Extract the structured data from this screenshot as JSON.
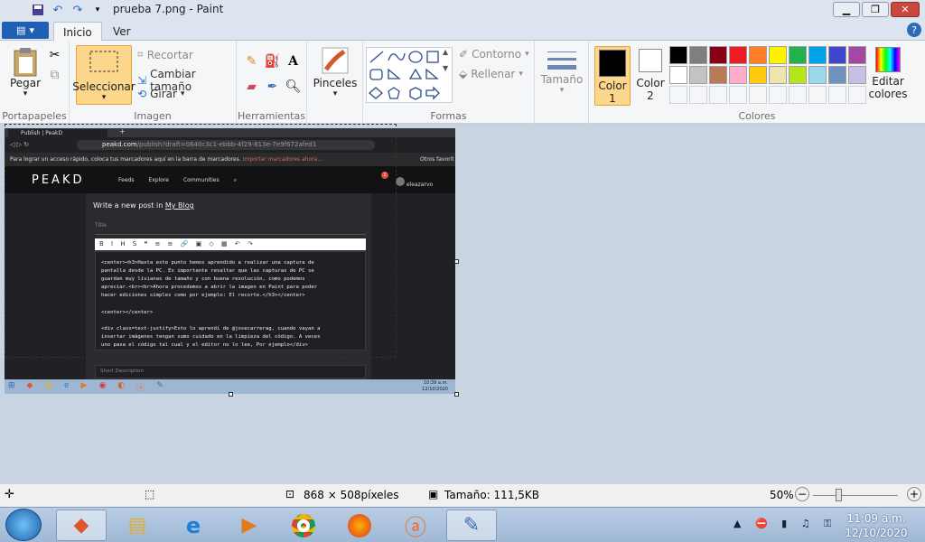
{
  "window": {
    "title": "prueba 7.png - Paint"
  },
  "tabs": [
    {
      "label": "Inicio"
    },
    {
      "label": "Ver"
    }
  ],
  "ribbon": {
    "clipboard": {
      "paste": "Pegar",
      "label": "Portapapeles"
    },
    "image": {
      "select": "Seleccionar",
      "crop": "Recortar",
      "resize": "Cambiar tamaño",
      "rotate": "Girar",
      "label": "Imagen"
    },
    "tools": {
      "label": "Herramientas"
    },
    "brushes": {
      "label": "Pinceles"
    },
    "shapes": {
      "outline": "Contorno",
      "fill": "Rellenar",
      "label": "Formas"
    },
    "size": {
      "label": "Tamaño"
    },
    "colors": {
      "color1_a": "Color",
      "color1_b": "1",
      "color2_a": "Color",
      "color2_b": "2",
      "edit_a": "Editar",
      "edit_b": "colores",
      "label": "Colores",
      "palette": [
        "#000000",
        "#7f7f7f",
        "#880015",
        "#ed1c24",
        "#ff7f27",
        "#fff200",
        "#22b14c",
        "#00a2e8",
        "#3f48cc",
        "#a349a4",
        "#ffffff",
        "#c3c3c3",
        "#b97a57",
        "#ffaec9",
        "#ffc90e",
        "#efe4b0",
        "#b5e61d",
        "#99d9ea",
        "#7092be",
        "#c8bfe7",
        "#f5f6f7",
        "#f5f6f7",
        "#f5f6f7",
        "#f5f6f7",
        "#f5f6f7",
        "#f5f6f7",
        "#f5f6f7",
        "#f5f6f7",
        "#f5f6f7",
        "#f5f6f7"
      ]
    }
  },
  "screenshot": {
    "tab_title": "Publish | PeakD",
    "url_host": "peakd.com",
    "url_path": "/publish?draft=0640c3c1-ebbb-4f29-813e-7e9f672afed1",
    "bookmark_hint": "Para lograr un acceso rápido, coloca tus marcadores aquí en la barra de marcadores.",
    "bookmark_link": "Importar marcadores ahora...",
    "other_favs": "Otros favorit",
    "brand": "PEAKD",
    "nav": [
      "Feeds",
      "Explore",
      "Communities"
    ],
    "user": "eleazarvo",
    "notif_count": "1",
    "heading_prefix": "Write a new post in",
    "heading_blog": "My Blog",
    "title_placeholder": "Title",
    "editor_lines": [
      "<center><h3>Hasta este punto hemos aprendido a realizar una captura de",
      "pantalla desde la PC. Es importante resaltar que las capturas de PC se",
      "guardan muy livianas de tamaño y con buena resolución, como podemos",
      "apreciar.<br><br>Ahora procedemos a abrir la imagen en Paint para poder",
      "hacer ediciones simples como por ejemplo: El recorte.</h3></center>",
      "",
      "<center></center>",
      "",
      "<div class=text-justify>Esto lo aprendí de @josecarrerag, cuando vayan a",
      "insertar imágenes tengan sumo cuidado en la limpieza del código. A veces",
      "uno pasa el código tal cual y el editor no lo lee, Por ejemplo</div>"
    ],
    "short_desc": "Short Description",
    "time": "10:39 a.m.",
    "date": "12/10/2020"
  },
  "status": {
    "dimensions": "868 × 508píxeles",
    "filesize": "Tamaño: 111,5KB",
    "zoom": "50%"
  },
  "taskbar": {
    "time": "11:09 a.m.",
    "date": "12/10/2020"
  }
}
